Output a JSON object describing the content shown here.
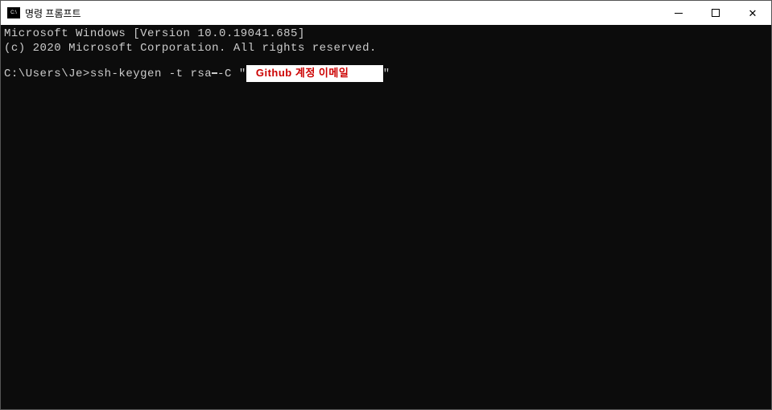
{
  "title_bar": {
    "title": "명령 프롬프트"
  },
  "terminal": {
    "line1": "Microsoft Windows [Version 10.0.19041.685]",
    "line2": "(c) 2020 Microsoft Corporation. All rights reserved.",
    "prompt": "C:\\Users\\Je>",
    "command_pre": "ssh-keygen -t rsa",
    "command_mid": "-C \"",
    "highlight_text": " Github 계정 이메일",
    "command_end": "\""
  }
}
